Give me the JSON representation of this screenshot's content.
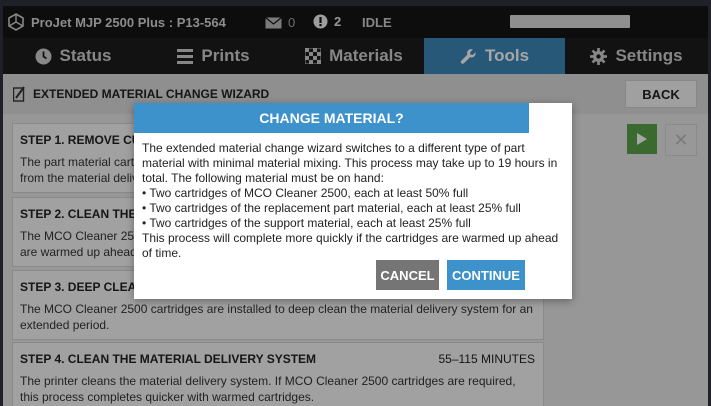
{
  "topbar": {
    "printer_name": "ProJet MJP 2500 Plus : P13-564",
    "mail_count": "0",
    "alert_count": "2",
    "state": "IDLE"
  },
  "tabs": [
    {
      "label": "Status",
      "icon": "clock-icon",
      "active": false
    },
    {
      "label": "Prints",
      "icon": "list-icon",
      "active": false
    },
    {
      "label": "Materials",
      "icon": "checkerboard-icon",
      "active": false
    },
    {
      "label": "Tools",
      "icon": "wrench-icon",
      "active": true
    },
    {
      "label": "Settings",
      "icon": "gear-icon",
      "active": false
    }
  ],
  "wizard": {
    "title": "EXTENDED MATERIAL CHANGE WIZARD",
    "back_label": "BACK",
    "steps": [
      {
        "title": "STEP 1. REMOVE CUR",
        "description": "The part material cart\nfrom the material deliv",
        "duration": ""
      },
      {
        "title": "STEP 2. CLEAN THE M",
        "description": "The MCO Cleaner 2500\nare warmed up ahead",
        "duration": ""
      },
      {
        "title": "STEP 3. DEEP CLEAN",
        "description": "The MCO Cleaner 2500 cartridges are installed to deep clean the material delivery system for an extended period.",
        "duration": ""
      },
      {
        "title": "STEP 4. CLEAN THE MATERIAL DELIVERY SYSTEM",
        "description": "The printer cleans the material delivery system. If MCO Cleaner 2500 cartridges are required, this process completes quicker with warmed cartridges.",
        "duration": "55–115 MINUTES"
      }
    ]
  },
  "modal": {
    "title": "CHANGE MATERIAL?",
    "intro": "The extended material change wizard switches to a different type of part material with minimal material mixing. This process may take up to 19 hours in total. The following material must be on hand:",
    "items": [
      "• Two cartridges of MCO Cleaner 2500, each at least 50% full",
      "• Two cartridges of the replacement part material, each at least 25% full",
      "• Two cartridges of the support material, each at least 25% full"
    ],
    "outro": "This process will complete more quickly if the cartridges are warmed up ahead of time.",
    "cancel_label": "CANCEL",
    "continue_label": "CONTINUE"
  },
  "colors": {
    "accent": "#3d92cb",
    "tab_active": "#3d87b9",
    "play": "#5aa44a",
    "cancel": "#757575"
  }
}
